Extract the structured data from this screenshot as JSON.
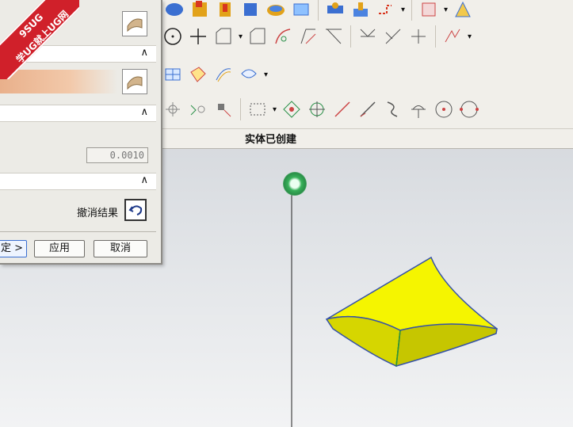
{
  "watermark": {
    "line1": "9SUG",
    "line2": "学UG就上UG网"
  },
  "dialog": {
    "value_field": "0.0010",
    "undo_label": "撤消结果",
    "buttons": {
      "ok": "定 >",
      "apply": "应用",
      "cancel": "取消"
    }
  },
  "status": {
    "message": "实体已创建"
  },
  "colors": {
    "accent": "#3b6fd1",
    "solid_face": "#f5f500",
    "solid_side": "#cfcf00",
    "edge": "#3552a8",
    "badge": "#d0202a"
  },
  "icons": [
    "sphere-icon",
    "block-icon",
    "cylinder-icon",
    "cone-icon",
    "torus-icon",
    "sketch-icon",
    "circle-icon",
    "point-icon",
    "spline-icon",
    "line-icon",
    "arc-icon"
  ]
}
